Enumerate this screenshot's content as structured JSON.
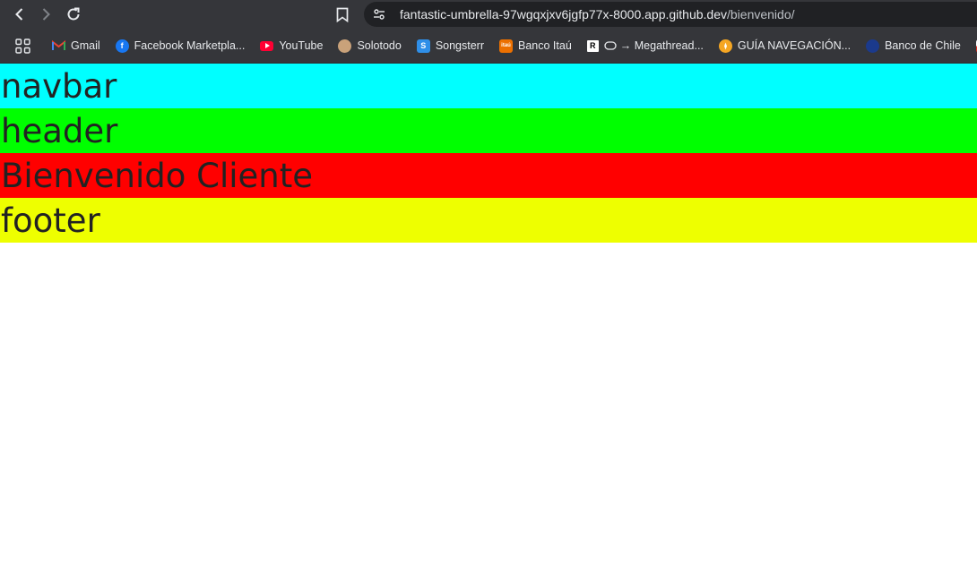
{
  "browser": {
    "url_host": "fantastic-umbrella-97wgqxjxv6jgfp77x-8000.app.github.dev",
    "url_path": "/bienvenido/",
    "bookmarks": [
      {
        "label": "Gmail",
        "icon": "gmail-icon",
        "color": "#ea4335"
      },
      {
        "label": "Facebook Marketpla...",
        "icon": "facebook-icon",
        "color": "#1877f2"
      },
      {
        "label": "YouTube",
        "icon": "youtube-icon",
        "color": "#ff0033"
      },
      {
        "label": "Solotodo",
        "icon": "solotodo-icon",
        "color": "#c9a27a"
      },
      {
        "label": "Songsterr",
        "icon": "songsterr-icon",
        "color": "#2f8fe8"
      },
      {
        "label": "Banco Itaú",
        "icon": "itau-icon",
        "color": "#ec7000"
      },
      {
        "label": "→ Megathread...",
        "icon": "megathread-icon",
        "color": "#ffffff"
      },
      {
        "label": "GUÍA NAVEGACIÓN...",
        "icon": "compass-icon",
        "color": "#f5a623"
      },
      {
        "label": "Banco de Chile",
        "icon": "banco-chile-icon",
        "color": "#1b3a8c"
      }
    ]
  },
  "page": {
    "navbar": {
      "text": "navbar",
      "color": "#00ffff"
    },
    "header": {
      "text": "header",
      "color": "#00ff00"
    },
    "main": {
      "text": "Bienvenido Cliente",
      "color": "#ff0000"
    },
    "footer": {
      "text": "footer",
      "color": "#eeff00"
    }
  }
}
